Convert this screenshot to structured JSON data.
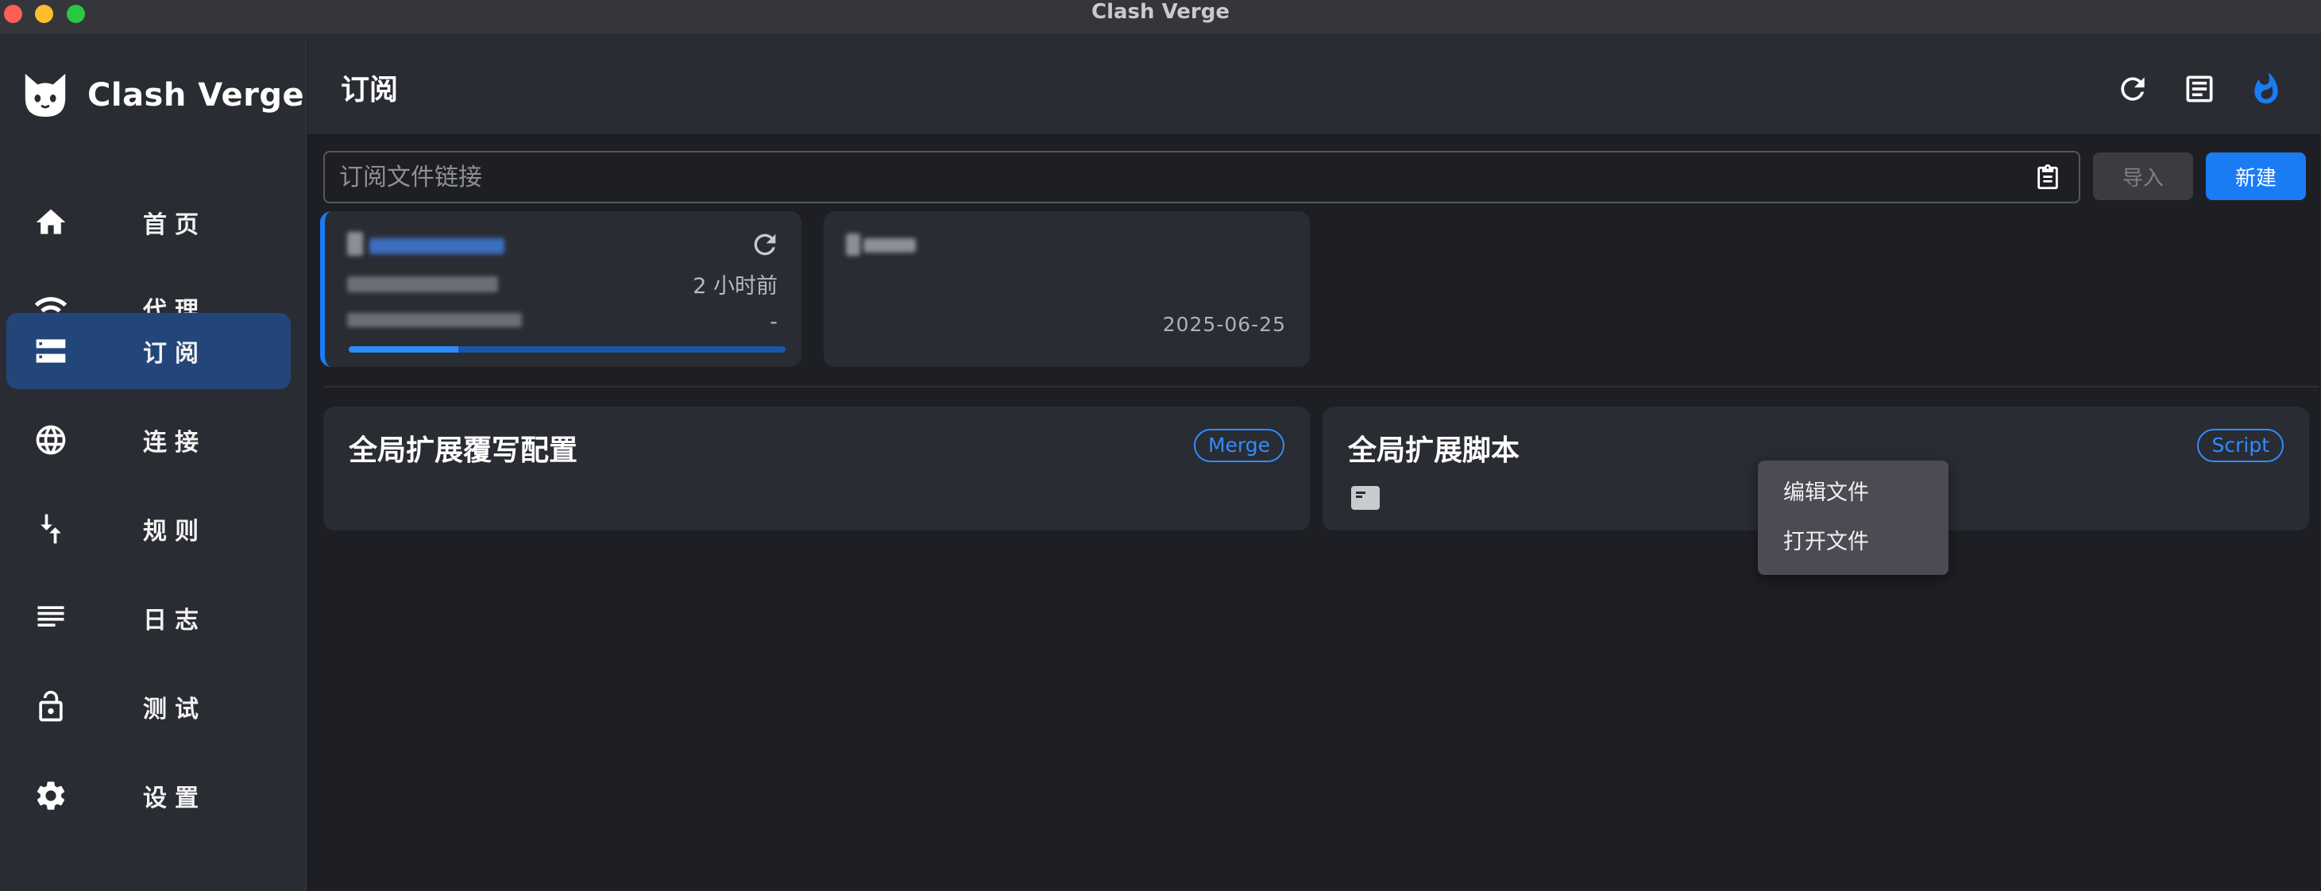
{
  "window": {
    "title": "Clash Verge"
  },
  "sidebar": {
    "app_name": "Clash Verge",
    "items": [
      {
        "label": "首页",
        "icon": "home-icon",
        "active": false
      },
      {
        "label": "代理",
        "icon": "wifi-icon",
        "active": false
      },
      {
        "label": "订阅",
        "icon": "storage-icon",
        "active": true
      },
      {
        "label": "连接",
        "icon": "globe-icon",
        "active": false
      },
      {
        "label": "规则",
        "icon": "fork-arrow-icon",
        "active": false
      },
      {
        "label": "日志",
        "icon": "list-lines-icon",
        "active": false
      },
      {
        "label": "测试",
        "icon": "lock-icon",
        "active": false
      },
      {
        "label": "设置",
        "icon": "gear-icon",
        "active": false
      }
    ]
  },
  "header": {
    "title": "订阅",
    "actions": [
      "refresh-icon",
      "document-icon",
      "fire-icon"
    ]
  },
  "search": {
    "placeholder": "订阅文件链接",
    "value": ""
  },
  "buttons": {
    "import": "导入",
    "new": "新建"
  },
  "profiles": [
    {
      "updated": "2 小时前",
      "expire": "-",
      "usage_fraction": 0.25,
      "selected": true
    },
    {
      "date": "2025-06-25",
      "selected": false
    }
  ],
  "global": {
    "merge": {
      "title": "全局扩展覆写配置",
      "tag": "Merge"
    },
    "script": {
      "title": "全局扩展脚本",
      "tag": "Script"
    }
  },
  "context_menu": {
    "items": [
      "编辑文件",
      "打开文件"
    ]
  },
  "colors": {
    "accent": "#1a7cf5",
    "active_nav": "#23467a",
    "background": "#1e1f25",
    "panel": "#2a2c33"
  }
}
